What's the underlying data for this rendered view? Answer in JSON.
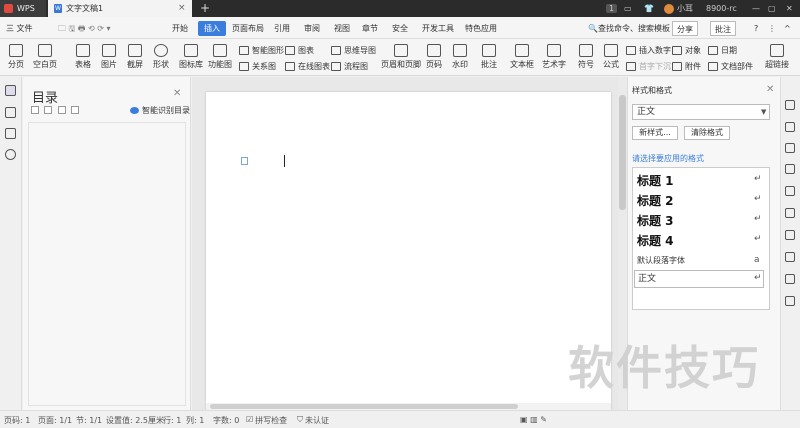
{
  "titlebar": {
    "app_name": "WPS",
    "doc_tab": "文字文稿1",
    "badge": "1",
    "user": "小耳",
    "user_id": "8900-rc"
  },
  "ribbon_tabs": {
    "menu": "三 文件",
    "items": [
      "开始",
      "插入",
      "页面布局",
      "引用",
      "审阅",
      "视图",
      "章节",
      "安全",
      "开发工具",
      "特色应用"
    ],
    "search": "查找命令、搜索模板",
    "share": "分享",
    "comment": "批注"
  },
  "toolbar": {
    "page_break": "分页",
    "blank_page": "空白页",
    "table": "表格",
    "picture": "图片",
    "screenshot": "截屏",
    "shape": "形状",
    "icon_lib": "图标库",
    "func_chart": "功能图",
    "smart_shape": "智能图形",
    "relation_chart": "关系图",
    "chart": "图表",
    "online_chart": "在线图表",
    "mindmap": "思维导图",
    "flowchart": "流程图",
    "header_footer": "页眉和页脚",
    "page_number": "页码",
    "watermark": "水印",
    "comment": "批注",
    "textbox": "文本框",
    "art_text": "艺术字",
    "symbol": "符号",
    "formula": "公式",
    "insert_number": "插入数字",
    "first_letter": "首字下沉",
    "object": "对象",
    "attachment": "附件",
    "date": "日期",
    "doc_parts": "文档部件",
    "hyperlink": "超链接"
  },
  "toc": {
    "title": "目录",
    "smart_toc": "智能识别目录"
  },
  "styles_panel": {
    "title": "样式和格式",
    "current": "正文",
    "new_style": "新样式...",
    "clear_format": "清除格式",
    "prompt": "请选择要应用的格式",
    "items": [
      "标题 1",
      "标题 2",
      "标题 3",
      "标题 4"
    ],
    "default_font": "默认段落字体",
    "normal": "正文"
  },
  "statusbar": {
    "page_num": "页码: 1",
    "pages": "页面: 1/1",
    "section": "节: 1/1",
    "setting": "设置值: 2.5厘米",
    "row": "行: 1",
    "col": "列: 1",
    "word_count": "字数: 0",
    "spellcheck": "拼写检查",
    "cert": "未认证"
  },
  "watermark_text": "软件技巧"
}
